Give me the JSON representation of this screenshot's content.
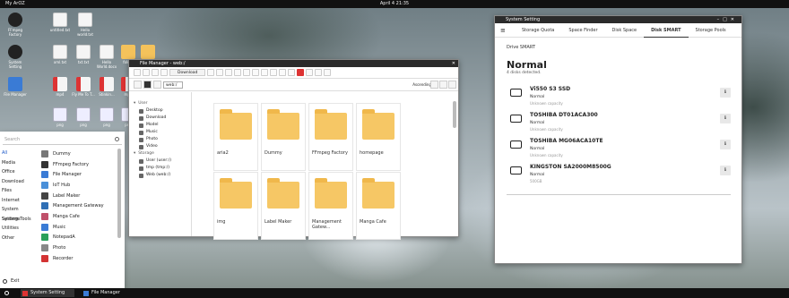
{
  "topbar": {
    "app": "My ArOZ",
    "clock": "April 4 21:35"
  },
  "desktop": {
    "icons": [
      {
        "label": "FFmpeg Factory",
        "type": "gear",
        "icon": "ffmpeg-icon"
      },
      {
        "label": "untitled.txt",
        "type": "doc",
        "icon": "text-file-icon"
      },
      {
        "label": "Hello world.txt",
        "type": "doc",
        "icon": "text-file-icon"
      },
      {
        "label": "System Setting",
        "type": "gear",
        "icon": "gear-icon"
      },
      {
        "label": "xml.txt",
        "type": "doc",
        "icon": "text-file-icon"
      },
      {
        "label": "txt.txt",
        "type": "doc",
        "icon": "text-file-icon"
      },
      {
        "label": "Hello World.docx",
        "type": "doc",
        "icon": "doc-file-icon"
      },
      {
        "label": "folder",
        "type": "folder",
        "icon": "folder-icon"
      },
      {
        "label": "File Manager",
        "type": "blue",
        "icon": "file-manager-icon"
      },
      {
        "label": "mp4",
        "type": "red",
        "icon": "video-file-icon"
      },
      {
        "label": "Fly Me To T...",
        "type": "red",
        "icon": "video-file-icon"
      },
      {
        "label": "Stinkin...",
        "type": "red",
        "icon": "video-file-icon"
      },
      {
        "label": "mp4",
        "type": "red",
        "icon": "video-file-icon"
      },
      {
        "label": "folder",
        "type": "folder",
        "icon": "folder-icon"
      },
      {
        "label": "png",
        "type": "img",
        "icon": "image-file-icon"
      },
      {
        "label": "png",
        "type": "img",
        "icon": "image-file-icon"
      },
      {
        "label": "png",
        "type": "img",
        "icon": "image-file-icon"
      },
      {
        "label": "png",
        "type": "img",
        "icon": "image-file-icon"
      }
    ]
  },
  "file_manager": {
    "title": "File Manager - web:/",
    "download_label": "Download",
    "path": "web:/",
    "sort": "Ascending",
    "sidebar": [
      {
        "label": "User",
        "group": true
      },
      {
        "label": "Desktop",
        "group": false
      },
      {
        "label": "Download",
        "group": false
      },
      {
        "label": "Model",
        "group": false
      },
      {
        "label": "Music",
        "group": false
      },
      {
        "label": "Photo",
        "group": false
      },
      {
        "label": "Video",
        "group": false
      },
      {
        "label": "Storage",
        "group": true
      },
      {
        "label": "User (user:/)",
        "group": false
      },
      {
        "label": "tmp (tmp:/)",
        "group": false
      },
      {
        "label": "Web (web:/)",
        "group": false
      }
    ],
    "folders": [
      "aria2",
      "Dummy",
      "FFmpeg Factory",
      "homepage",
      "img",
      "Label Maker",
      "Management Gatew...",
      "Manga Cafe"
    ]
  },
  "start_menu": {
    "search_placeholder": "Search",
    "categories": [
      "All",
      "Media",
      "Office",
      "Download",
      "Files",
      "Internet",
      "System Settings",
      "System Tools",
      "Utilities",
      "Other"
    ],
    "apps": [
      {
        "label": "Dummy",
        "color": "#777777"
      },
      {
        "label": "FFmpeg Factory",
        "color": "#333333"
      },
      {
        "label": "File Manager",
        "color": "#3a7bd5"
      },
      {
        "label": "IoT Hub",
        "color": "#4a90d9"
      },
      {
        "label": "Label Maker",
        "color": "#444444"
      },
      {
        "label": "Management Gateway",
        "color": "#2f6fb5"
      },
      {
        "label": "Manga Cafe",
        "color": "#c0506a"
      },
      {
        "label": "Music",
        "color": "#3a7bd5"
      },
      {
        "label": "NotepadA",
        "color": "#2aa05a"
      },
      {
        "label": "Photo",
        "color": "#888888"
      },
      {
        "label": "Recorder",
        "color": "#d33333"
      }
    ],
    "exit_label": "Exit"
  },
  "system_setting": {
    "title": "System Setting",
    "tabs": [
      "Storage Quota",
      "Space Finder",
      "Disk Space",
      "Disk SMART",
      "Storage Pools"
    ],
    "active_tab": "Disk SMART",
    "crumb": "Drive SMART",
    "heading": "Normal",
    "subheading": "4 disks detected.",
    "disks": [
      {
        "name": "Vi550 S3 SSD",
        "status": "Normal",
        "capacity": "Unknown capacity"
      },
      {
        "name": "TOSHIBA DT01ACA300",
        "status": "Normal",
        "capacity": "Unknown capacity"
      },
      {
        "name": "TOSHIBA MG06ACA10TE",
        "status": "Normal",
        "capacity": "Unknown capacity"
      },
      {
        "name": "KINGSTON SA2000M8500G",
        "status": "Normal",
        "capacity": "500GB"
      }
    ]
  },
  "taskbar": {
    "items": [
      {
        "label": "System Setting",
        "icon": "gear-icon"
      },
      {
        "label": "File Manager",
        "icon": "file-manager-icon"
      }
    ]
  }
}
